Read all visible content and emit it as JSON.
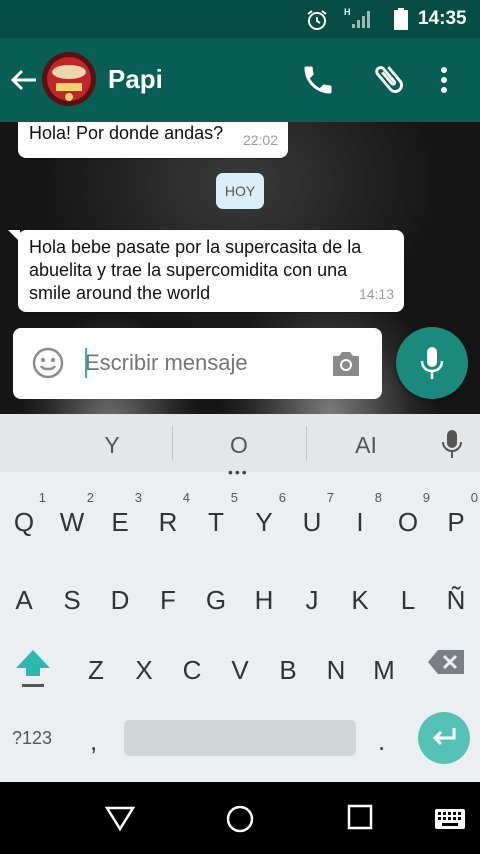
{
  "status_bar": {
    "time": "14:35",
    "network_label": "H",
    "icons": [
      "alarm-icon",
      "signal-icon",
      "battery-icon"
    ]
  },
  "app_bar": {
    "contact_name": "Papi",
    "icons": [
      "back-arrow-icon",
      "phone-icon",
      "paperclip-icon",
      "more-vert-icon"
    ],
    "color": "#075e54"
  },
  "chat": {
    "messages": [
      {
        "text": "Hola! Por donde andas?",
        "time": "22:02"
      },
      {
        "text": "Hola bebe pasate por la supercasita de la abuelita y trae la supercomidita con una smile around the world",
        "time": "14:13"
      }
    ],
    "date_divider": "HOY"
  },
  "composer": {
    "placeholder": "Escribir mensaje",
    "icons": [
      "emoji-icon",
      "camera-icon",
      "mic-icon"
    ],
    "fab_color": "#1a8a7d"
  },
  "keyboard": {
    "suggestions": [
      "Y",
      "O",
      "AI"
    ],
    "row1": [
      {
        "label": "Q",
        "hint": "1"
      },
      {
        "label": "W",
        "hint": "2"
      },
      {
        "label": "E",
        "hint": "3"
      },
      {
        "label": "R",
        "hint": "4"
      },
      {
        "label": "T",
        "hint": "5"
      },
      {
        "label": "Y",
        "hint": "6"
      },
      {
        "label": "U",
        "hint": "7"
      },
      {
        "label": "I",
        "hint": "8"
      },
      {
        "label": "O",
        "hint": "9"
      },
      {
        "label": "P",
        "hint": "0"
      }
    ],
    "row2": [
      "A",
      "S",
      "D",
      "F",
      "G",
      "H",
      "J",
      "K",
      "L",
      "Ñ"
    ],
    "row3": [
      "Z",
      "X",
      "C",
      "V",
      "B",
      "N",
      "M"
    ],
    "symbols_label": "?123",
    "comma_label": ",",
    "period_label": ".",
    "accent_color": "#54c3b5"
  },
  "nav_bar": {
    "icons": [
      "back-triangle-icon",
      "home-circle-icon",
      "recents-square-icon",
      "keyboard-switch-icon"
    ]
  }
}
